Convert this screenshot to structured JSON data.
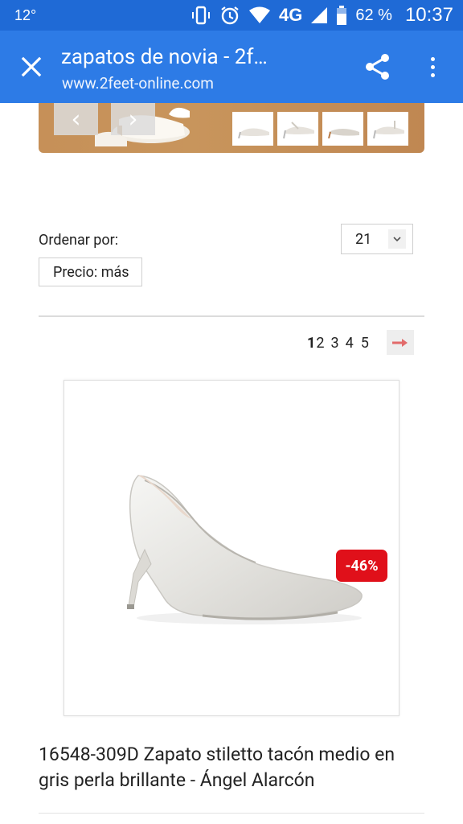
{
  "status_bar": {
    "temperature": "12°",
    "network": "4G",
    "battery_percent": "62 %",
    "time": "10:37",
    "icons": [
      "vibrate-icon",
      "alarm-icon",
      "wifi-icon",
      "signal-icon",
      "battery-icon"
    ]
  },
  "toolbar": {
    "title": "zapatos de novia - 2f…",
    "url": "www.2feet-online.com",
    "close_icon": "close-icon",
    "share_icon": "share-icon",
    "menu_icon": "more-vert-icon"
  },
  "banner": {
    "prev_label": "‹",
    "next_label": "›",
    "thumbnail_count": 4
  },
  "sort": {
    "label": "Ordenar por:",
    "selected": "Precio: más",
    "per_page": "21"
  },
  "pagination": {
    "pages": [
      "1",
      "2",
      "3",
      "4",
      "5"
    ],
    "current": "1",
    "next_icon": "arrow-right-icon"
  },
  "product": {
    "title": "16548-309D Zapato stiletto tacón medio en gris perla brillante - Ángel Alarcón",
    "discount": "-46%"
  },
  "colors": {
    "status_bar": "#1f6ad6",
    "toolbar": "#2d7be6",
    "discount_badge": "#e0101a",
    "next_arrow": "#e26b6b"
  }
}
